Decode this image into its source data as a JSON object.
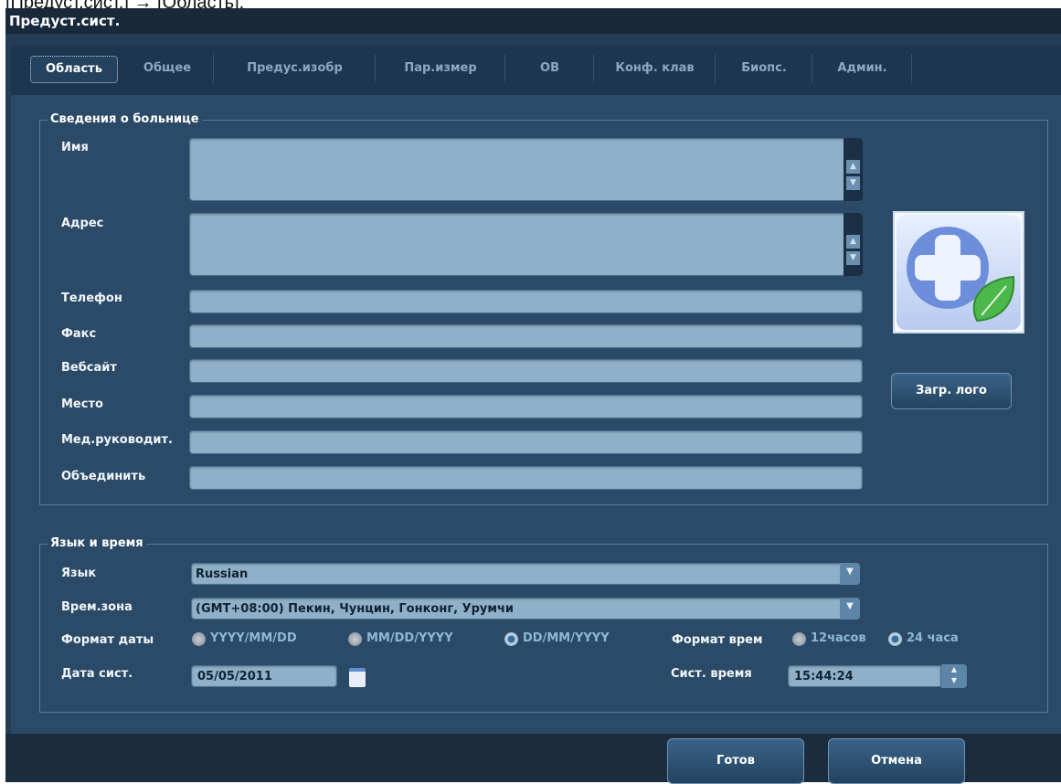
{
  "caption": "[Предуст.сист.] → [Область].",
  "window": {
    "title": "Предуст.сист."
  },
  "tabs": [
    {
      "label": "Область"
    },
    {
      "label": "Общее"
    },
    {
      "label": "Предус.изобр"
    },
    {
      "label": "Пар.измер"
    },
    {
      "label": "ОВ"
    },
    {
      "label": "Конф. клав"
    },
    {
      "label": "Биопс."
    },
    {
      "label": "Админ."
    }
  ],
  "hospital": {
    "title": "Сведения о больнице",
    "fields": {
      "name": {
        "label": "Имя",
        "value": ""
      },
      "address": {
        "label": "Адрес",
        "value": ""
      },
      "phone": {
        "label": "Телефон",
        "value": ""
      },
      "fax": {
        "label": "Факс",
        "value": ""
      },
      "website": {
        "label": "Вебсайт",
        "value": ""
      },
      "place": {
        "label": "Место",
        "value": ""
      },
      "head": {
        "label": "Мед.руководит.",
        "value": ""
      },
      "merge": {
        "label": "Объединить",
        "value": ""
      }
    },
    "load_logo": "Загр. лого"
  },
  "lang_time": {
    "title": "Язык и время",
    "language_label": "Язык",
    "language_value": "Russian",
    "timezone_label": "Врем.зона",
    "timezone_value": "(GMT+08:00) Пекин, Чунцин, Гонконг, Урумчи",
    "date_format_label": "Формат даты",
    "date_formats": [
      "YYYY/MM/DD",
      "MM/DD/YYYY",
      "DD/MM/YYYY"
    ],
    "date_format_selected": "DD/MM/YYYY",
    "time_format_label": "Формат врем",
    "time_formats": [
      "12часов",
      "24 часа"
    ],
    "time_format_selected": "24 часа",
    "sys_date_label": "Дата сист.",
    "sys_date_value": "05/05/2011",
    "sys_time_label": "Сист. время",
    "sys_time_value": "15:44:24"
  },
  "buttons": {
    "ok": "Готов",
    "cancel": "Отмена"
  },
  "icons": {
    "logo": "medical-cross-leaf-icon",
    "calendar": "calendar-icon",
    "dropdown": "chevron-down-icon",
    "scroll_up": "scroll-up-icon",
    "scroll_down": "scroll-down-icon",
    "spinner": "spinner-icon"
  },
  "colors": {
    "window_bg": "#243d55",
    "panel_bg": "#2a4a68",
    "field_bg": "#8fb0c8",
    "radio_selected": "#2f6ea8"
  }
}
